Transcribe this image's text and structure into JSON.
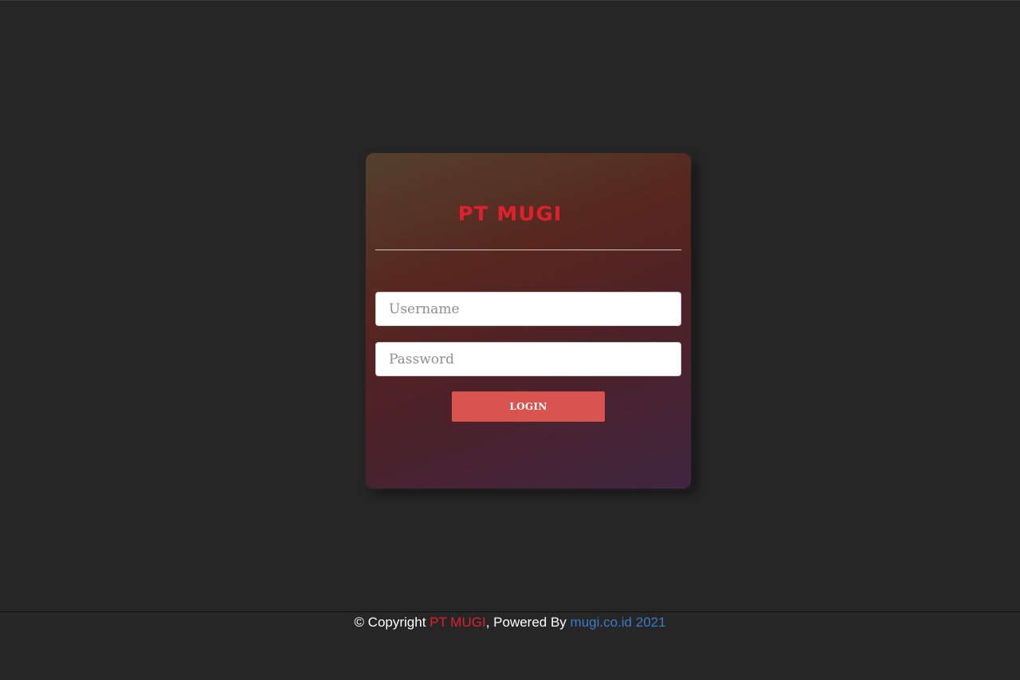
{
  "login": {
    "logo_text": "PT MUGI",
    "username_placeholder": "Username",
    "password_placeholder": "Password",
    "login_label": "LOGIN"
  },
  "footer": {
    "prefix": "© Copyright ",
    "brand": "PT MUGI",
    "middle": ", Powered By ",
    "link_text": "mugi.co.id 2021"
  },
  "colors": {
    "background": "#262626",
    "brand_red": "#e0202c",
    "button": "#d9534f",
    "link_blue": "#3a7cc7"
  }
}
